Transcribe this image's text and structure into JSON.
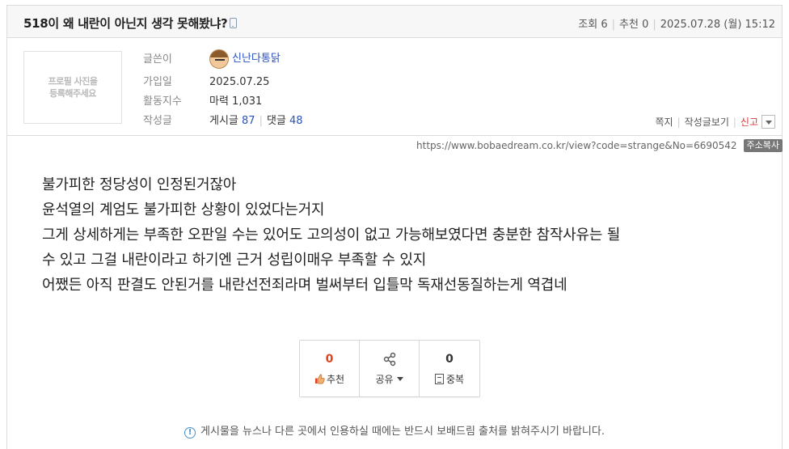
{
  "post": {
    "title": "518이 왜 내란이 아닌지 생각 못해봤냐?",
    "views_label": "조회",
    "views": "6",
    "recommend_label": "추천",
    "recommend": "0",
    "date": "2025.07.28 (월) 15:12"
  },
  "author": {
    "photo_placeholder": "프로필 사진을\n등록해주세요",
    "writer_label": "글쓴이",
    "nickname": "신난다통닭",
    "joined_label": "가입일",
    "joined": "2025.07.25",
    "activity_label": "활동지수",
    "activity_value": "마력 1,031",
    "posts_label": "작성글",
    "posts_prefix": "게시글",
    "posts_count": "87",
    "comments_prefix": "댓글",
    "comments_count": "48",
    "actions": {
      "message": "쪽지",
      "view_posts": "작성글보기",
      "report": "신고"
    }
  },
  "url": {
    "text": "https://www.bobaedream.co.kr/view?code=strange&No=6690542",
    "copy_label": "주소복사"
  },
  "body": [
    "불가피한 정당성이 인정된거잖아",
    "윤석열의 계엄도 불가피한 상황이 있었다는거지",
    "그게 상세하게는 부족한 오판일 수는 있어도 고의성이 없고 가능해보였다면 충분한 참작사유는 될",
    "수 있고 그걸 내란이라고 하기엔 근거 성립이매우 부족할 수 있지",
    "어쨌든 아직 판결도 안된거를 내란선전죄라며 벌써부터 입틀막 독재선동질하는게 역겹네"
  ],
  "buttons": {
    "recommend_count": "0",
    "recommend_label": "추천",
    "share_label": "공유",
    "duplicate_count": "0",
    "duplicate_label": "중복"
  },
  "notice": "게시물을 뉴스나 다른 곳에서 인용하실 때에는 반드시 보배드림 출처를 밝혀주시기 바랍니다.",
  "colors": {
    "link": "#2a52be",
    "report": "#d23c3c",
    "recommend_count": "#e0431f",
    "notice_icon": "#4a90c8"
  },
  "icons": [
    "mobile-icon",
    "avatar",
    "dropdown-icon",
    "share-icon",
    "thumbs-up-icon",
    "document-icon",
    "info-icon"
  ]
}
